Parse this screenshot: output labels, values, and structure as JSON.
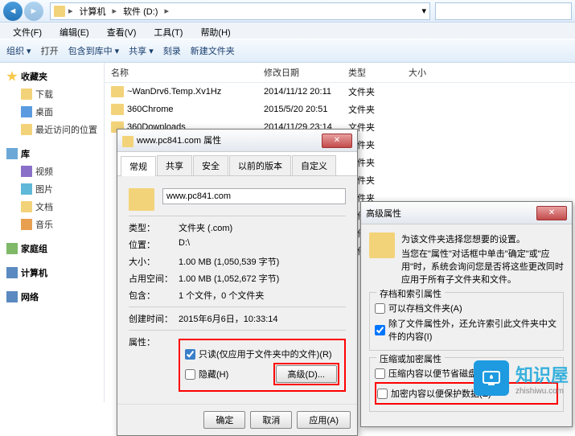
{
  "nav": {
    "back": "◄",
    "fwd": "►",
    "segs": [
      "计算机",
      "软件 (D:)"
    ],
    "dropdown": "▾"
  },
  "menu": [
    "文件(F)",
    "编辑(E)",
    "查看(V)",
    "工具(T)",
    "帮助(H)"
  ],
  "tb": {
    "org": "组织 ▾",
    "open": "打开",
    "include": "包含到库中 ▾",
    "share": "共享 ▾",
    "burn": "刻录",
    "newf": "新建文件夹"
  },
  "tree": {
    "fav": "收藏夹",
    "dl": "下载",
    "desk": "桌面",
    "recent": "最近访问的位置",
    "lib": "库",
    "vid": "视频",
    "pic": "图片",
    "doc": "文档",
    "mus": "音乐",
    "home": "家庭组",
    "comp": "计算机",
    "net": "网络"
  },
  "cols": [
    "名称",
    "修改日期",
    "类型",
    "大小"
  ],
  "files": [
    {
      "n": "~WanDrv6.Temp.Xv1Hz",
      "d": "2014/11/12 20:11",
      "t": "文件夹"
    },
    {
      "n": "360Chrome",
      "d": "2015/5/20 20:51",
      "t": "文件夹"
    },
    {
      "n": "360Downloads",
      "d": "2014/11/29 23:14",
      "t": "文件夹"
    }
  ],
  "ghosted": [
    "文件夹",
    "文件夹",
    "文件夹",
    "文件夹",
    "文件夹",
    "文件夹",
    "文件夹"
  ],
  "prop": {
    "title": "www.pc841.com 属性",
    "close": "✕",
    "tabs": [
      "常规",
      "共享",
      "安全",
      "以前的版本",
      "自定义"
    ],
    "name": "www.pc841.com",
    "rows": [
      [
        "类型：",
        "文件夹 (.com)"
      ],
      [
        "位置：",
        "D:\\"
      ],
      [
        "大小：",
        "1.00 MB (1,050,539 字节)"
      ],
      [
        "占用空间：",
        "1.00 MB (1,052,672 字节)"
      ],
      [
        "包含：",
        "1 个文件，0 个文件夹"
      ]
    ],
    "created_l": "创建时间：",
    "created_v": "2015年6月6日，10:33:14",
    "attr_l": "属性：",
    "ro": "只读(仅应用于文件夹中的文件)(R)",
    "hidden": "隐藏(H)",
    "adv": "高级(D)...",
    "ok": "确定",
    "cancel": "取消",
    "apply": "应用(A)"
  },
  "adv": {
    "title": "高级属性",
    "close": "✕",
    "intro1": "为该文件夹选择您想要的设置。",
    "intro2": "当您在\"属性\"对话框中单击\"确定\"或\"应用\"时，系统会询问您是否将这些更改同时应用于所有子文件夹和文件。",
    "g1": "存档和索引属性",
    "cb1": "可以存档文件夹(A)",
    "cb2": "除了文件属性外，还允许索引此文件夹中文件的内容(I)",
    "g2": "压缩或加密属性",
    "cb3": "压缩内容以便节省磁盘空间(C)",
    "cb4": "加密内容以便保护数据(E)"
  },
  "wm": {
    "name": "知识屋",
    "url": "zhishiwu.com"
  }
}
